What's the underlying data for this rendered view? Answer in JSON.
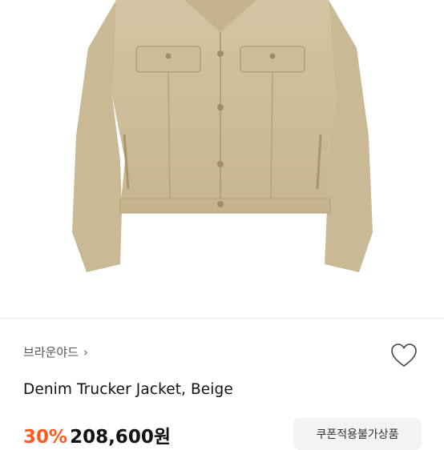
{
  "product": {
    "brand": "브라운야드",
    "brand_chevron": "›",
    "name": "Denim Trucker Jacket, Beige",
    "discount": "30%",
    "price": "208,600원",
    "coupon_badge": "쿠폰적용불가상품"
  },
  "colors": {
    "jacket": "#cfbf9c",
    "discount": "#ff5a1f"
  },
  "icons": {
    "wishlist": "heart-outline-icon",
    "brand_link": "chevron-right-icon"
  }
}
